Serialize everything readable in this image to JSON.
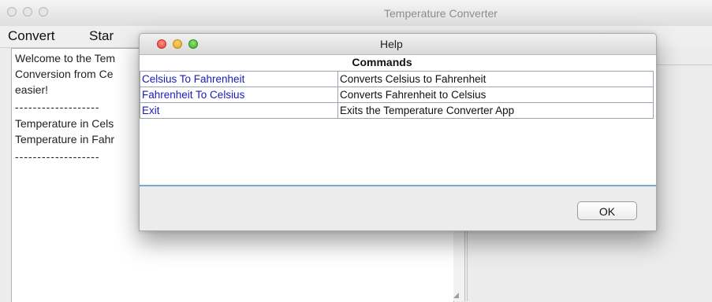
{
  "main_window": {
    "title": "Temperature Converter",
    "menu": [
      "Convert",
      "Star"
    ],
    "text_lines": [
      "Welcome to the Tem",
      "Conversion from Ce",
      "easier!",
      "-------------------",
      "Temperature in Cels",
      "Temperature in Fahr",
      "-------------------"
    ]
  },
  "dialog": {
    "title": "Help",
    "table_header": "Commands",
    "rows": [
      {
        "name": "Celsius To Fahrenheit",
        "description": "Converts Celsius to Fahrenheit"
      },
      {
        "name": "Fahrenheit To Celsius",
        "description": "Converts Fahrenheit to Celsius"
      },
      {
        "name": "Exit",
        "description": "Exits the Temperature Converter App"
      }
    ],
    "ok_label": "OK"
  },
  "icons": {
    "window_close": "close-icon",
    "window_minimize": "minimize-icon",
    "window_maximize": "maximize-icon",
    "resize": "resize-grip-icon"
  },
  "colors": {
    "link_blue": "#1a1ab8",
    "close_red": "#e0443a",
    "minimize_yellow": "#dfa024",
    "maximize_green": "#3ea82b"
  }
}
